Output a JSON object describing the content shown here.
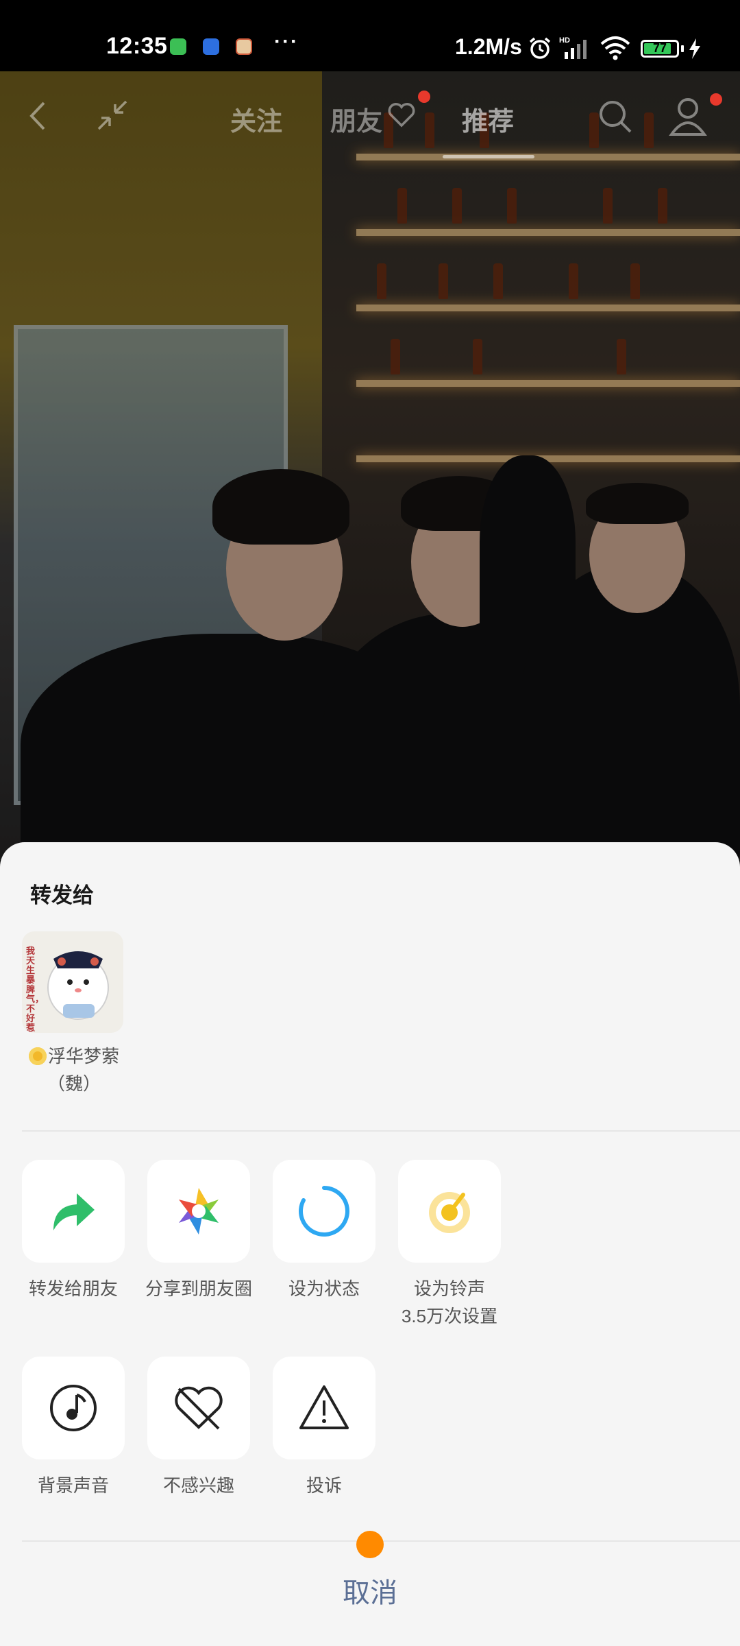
{
  "status_bar": {
    "time": "12:35",
    "network_speed": "1.2M/s",
    "battery_level": "77",
    "icons": [
      "wechat-mini-icon",
      "bird-app-icon",
      "cartoon-app-icon",
      "more-dots",
      "alarm-icon",
      "hd-signal-icon",
      "wifi-icon",
      "battery-icon",
      "charging-icon"
    ],
    "more_dots": "···"
  },
  "top_nav": {
    "tabs": [
      {
        "label": "关注"
      },
      {
        "label": "朋友"
      },
      {
        "label": "推荐"
      }
    ],
    "active_tab": "推荐"
  },
  "share_sheet": {
    "title": "转发给",
    "contacts": [
      {
        "name_line1": "浮华梦萦",
        "name_line2": "（魏）",
        "avatar_text": "我天生暴脾气，不好惹"
      }
    ],
    "actions_row1": [
      {
        "label": "转发给朋友",
        "icon": "share-arrow-icon"
      },
      {
        "label": "分享到朋友圈",
        "icon": "moments-icon"
      },
      {
        "label": "设为状态",
        "icon": "status-ring-icon"
      },
      {
        "label": "设为铃声",
        "sub": "3.5万次设置",
        "icon": "ringtone-icon"
      }
    ],
    "actions_row2": [
      {
        "label": "背景声音",
        "icon": "music-note-icon"
      },
      {
        "label": "不感兴趣",
        "icon": "broken-heart-icon"
      },
      {
        "label": "投诉",
        "icon": "warning-icon"
      }
    ],
    "cancel_label": "取消"
  },
  "colors": {
    "sheet_bg": "#f5f5f5",
    "accent_green": "#2fbe6a",
    "cancel_text": "#5b6f95",
    "floating_dot": "#ff8a00"
  }
}
